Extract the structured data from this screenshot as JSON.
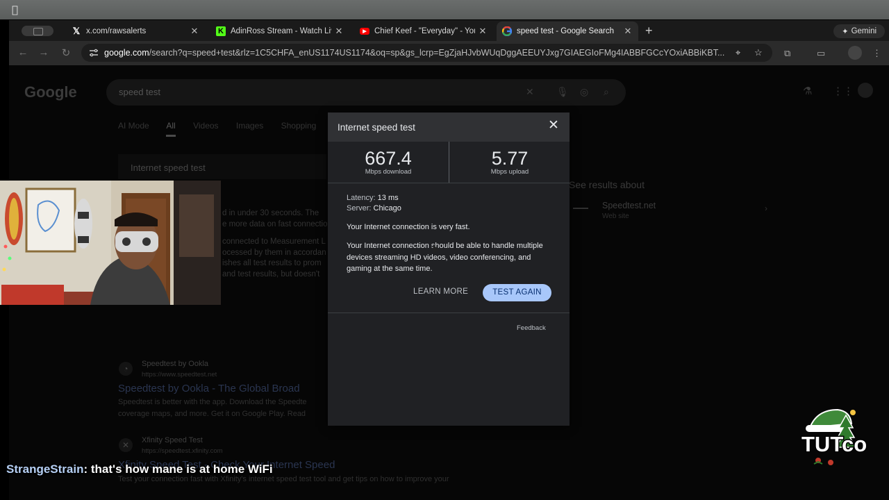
{
  "menubar": {
    "apple_glyph": ""
  },
  "tabs": [
    {
      "title": "x.com/rawsalerts",
      "favicon": "x-logo-icon"
    },
    {
      "title": "AdinRoss Stream - Watch Liv",
      "favicon": "kick-logo-icon"
    },
    {
      "title": "Chief Keef - \"Everyday\" - You",
      "favicon": "youtube-logo-icon"
    },
    {
      "title": "speed test - Google Search",
      "favicon": "google-logo-icon"
    }
  ],
  "gemini_label": "Gemini",
  "address_bar": {
    "domain": "google.com",
    "path": "/search?q=speed+test&rlz=1C5CHFA_enUS1174US1174&oq=sp&gs_lcrp=EgZjaHJvbWUqDggAEEUYJxg7GIAEGIoFMg4IABBFGCcYOxiABBiKBT..."
  },
  "search": {
    "logo": "Google",
    "query": "speed test",
    "filters": [
      "AI Mode",
      "All",
      "Videos",
      "Images",
      "Shopping",
      "Sh"
    ],
    "active_filter": "All",
    "card_title": "Internet speed test",
    "snippet_lines": [
      "d in under 30 seconds. The",
      "e more data on fast connectio",
      "",
      "connected to Measurement L",
      "ocessed by them in accordan",
      "ishes all test results to prom",
      "and test results, but doesn't"
    ],
    "results": [
      {
        "site": "Speedtest by Ookla",
        "url": "https://www.speedtest.net",
        "title": "Speedtest by Ookla - The Global Broad",
        "desc1": "Speedtest is better with the app. Download the Speedte",
        "desc2": "coverage maps, and more. Get it on Google Play. Read"
      },
      {
        "site": "Xfinity Speed Test",
        "url": "https://speedtest.xfinity.com",
        "title": "Xfinity Speed Test - Check Your Internet Speed",
        "desc1": "Test your connection fast with Xfinity's internet speed test tool and get tips on how to improve your"
      }
    ],
    "see_results_about": "See results about",
    "entity": {
      "name": "Speedtest.net",
      "type": "Web site"
    }
  },
  "dialog": {
    "title": "Internet speed test",
    "download": {
      "value": "667.4",
      "label": "Mbps download"
    },
    "upload": {
      "value": "5.77",
      "label": "Mbps upload"
    },
    "latency_label": "Latency:",
    "latency_value": "13 ms",
    "server_label": "Server:",
    "server_value": "Chicago",
    "verdict": "Your Internet connection is very fast.",
    "detail": "Your Internet connection should be able to handle multiple devices streaming HD videos, video conferencing, and gaming at the same time.",
    "learn_more": "LEARN MORE",
    "test_again": "TEST AGAIN",
    "feedback": "Feedback"
  },
  "chat": {
    "user": "StrangeStrain",
    "message": ": that's how mane is at home WiFi"
  },
  "badge_text": "TUTco",
  "colors": {
    "accent_button": "#a8c7fa",
    "dialog_bg": "#202124",
    "dialog_header": "#303134"
  }
}
